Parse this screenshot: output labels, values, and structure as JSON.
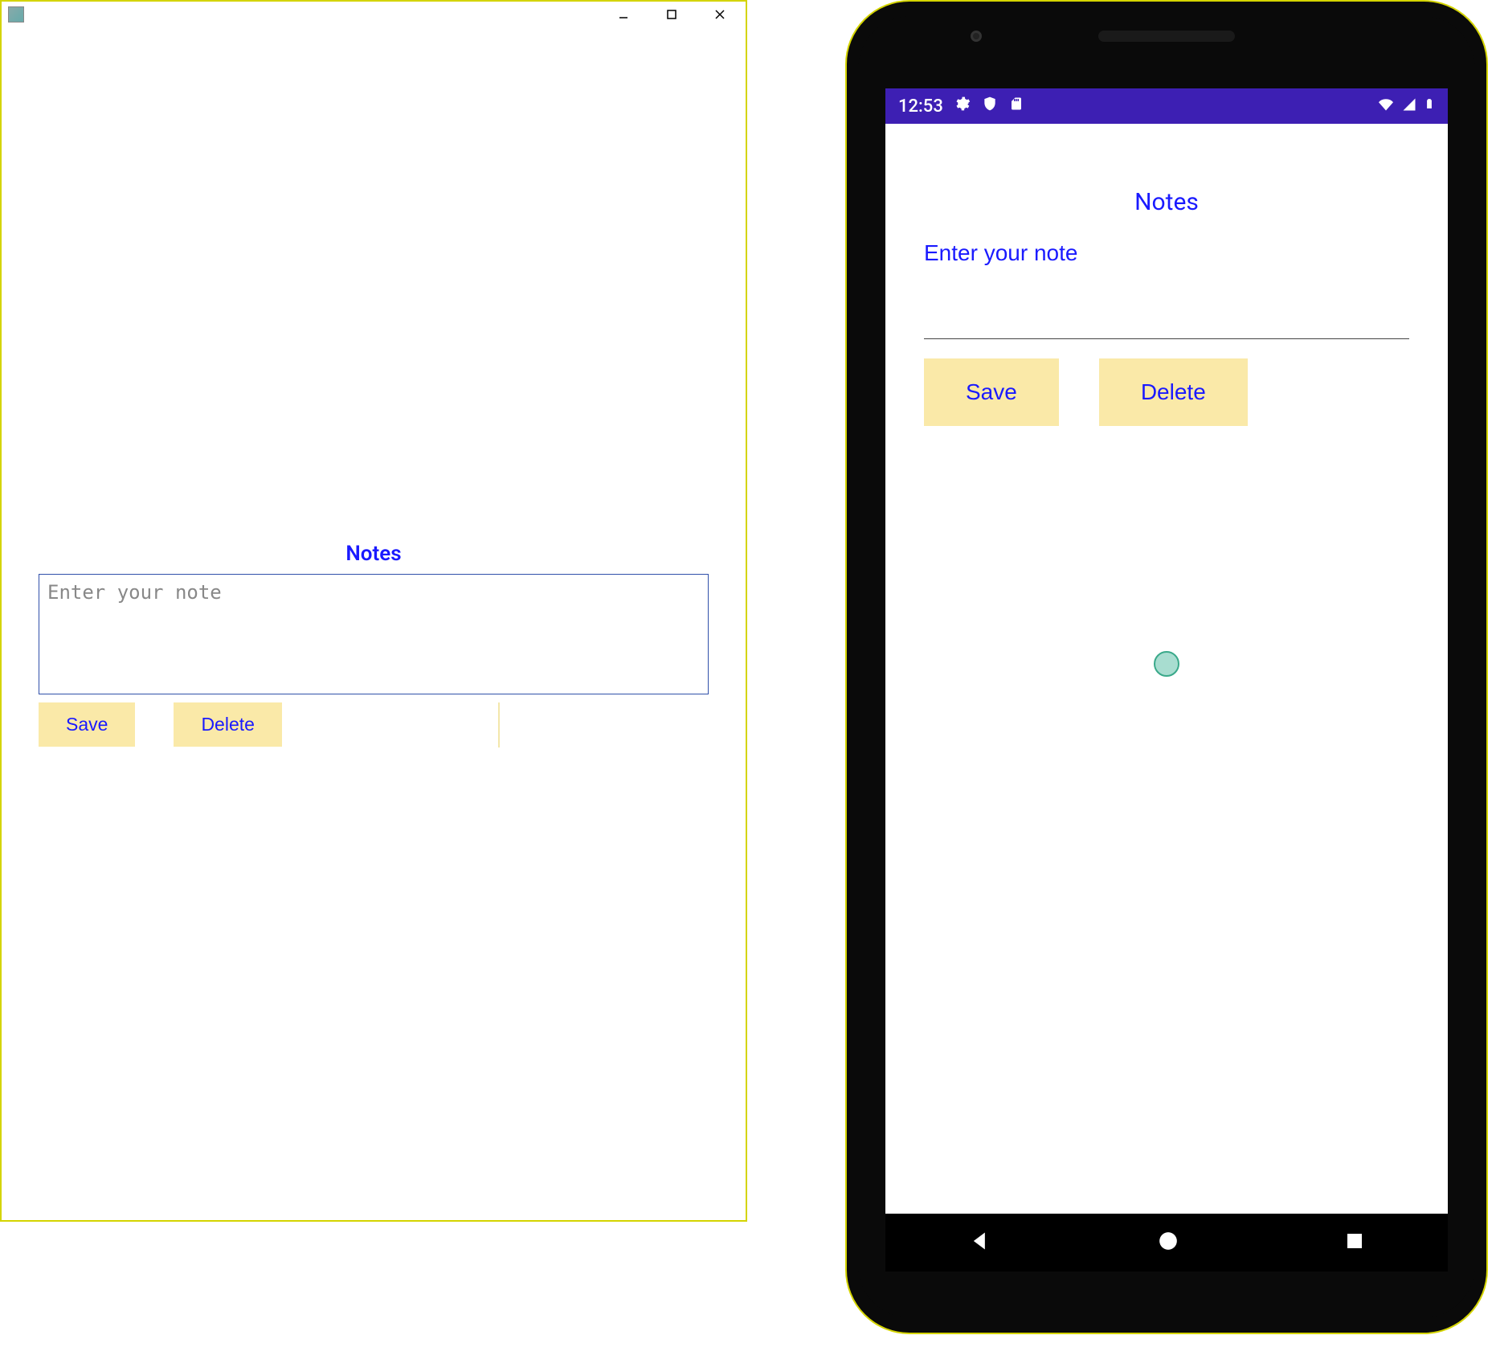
{
  "desktop": {
    "title": "Notes",
    "input_placeholder": "Enter your note",
    "save_label": "Save",
    "delete_label": "Delete"
  },
  "mobile": {
    "status": {
      "time": "12:53"
    },
    "title": "Notes",
    "input_placeholder": "Enter your note",
    "save_label": "Save",
    "delete_label": "Delete"
  },
  "colors": {
    "accent": "#1a1aff",
    "button_bg": "#fae9a8",
    "statusbar_bg": "#3d1fb3",
    "window_border": "#d4d400"
  }
}
